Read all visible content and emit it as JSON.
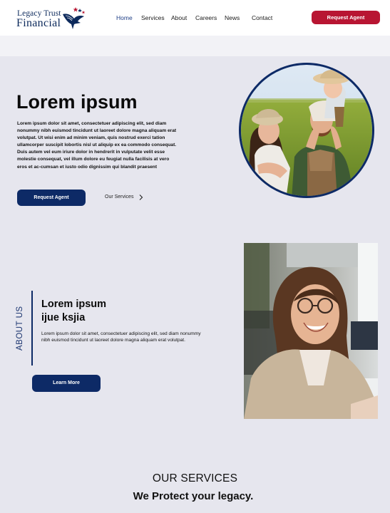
{
  "brand": {
    "name_line1": "Legacy Trust",
    "name_line2": "Financial",
    "colors": {
      "navy": "#0d2a66",
      "red": "#b81532"
    }
  },
  "nav": {
    "links": [
      "Home",
      "Services",
      "About",
      "Careers",
      "News",
      "Contact"
    ],
    "active": "Home",
    "cta_label": "Request Agent"
  },
  "hero": {
    "title": "Lorem ipsum",
    "body": "Lorem ipsum dolor sit amet, consectetuer adipiscing elit, sed diam nonummy nibh euismod tincidunt ut laoreet dolore magna aliquam erat volutpat. Ut wisi enim ad minim veniam, quis nostrud exerci tation ullamcorper suscipit lobortis nisl ut aliquip ex ea commodo consequat. Duis autem vel eum iriure dolor in hendrerit in vulputate velit esse molestie consequat, vel illum dolore eu feugiat nulla facilisis at vero eros et ac-cumsan et iusto odio dignissim qui blandit praesent",
    "cta_label": "Request Agent",
    "link_label": "Our Services"
  },
  "about": {
    "vertical_label": "ABOUT US",
    "title_line1": "Lorem ipsum",
    "title_line2": "ijue ksjia",
    "body": "Lorem ipsum dolor sit amet, consectetuer adipiscing elit, sed diam nonummy nibh euismod tincidunt ut laoreet dolore magna aliquam erat volutpat.",
    "cta_label": "Learn More"
  },
  "services": {
    "heading": "OUR SERVICES",
    "tagline": "We Protect your legacy."
  }
}
